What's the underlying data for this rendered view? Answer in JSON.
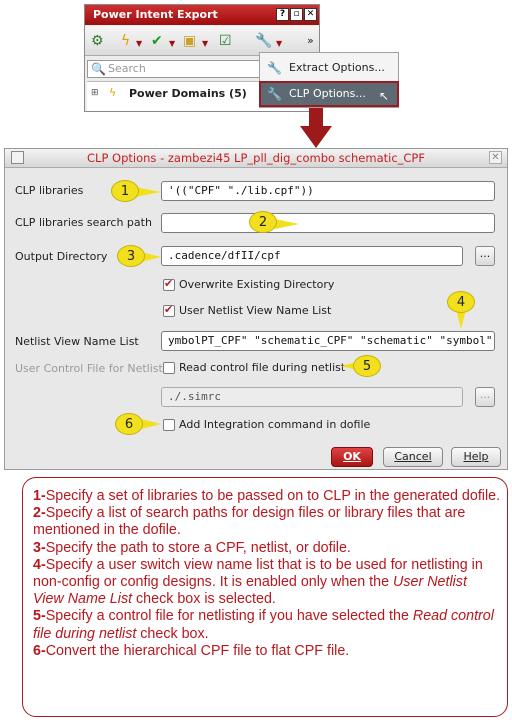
{
  "panel": {
    "title": "Power Intent Export",
    "search_placeholder": "Search",
    "tree_item": "Power Domains (5)"
  },
  "menu": {
    "items": [
      {
        "label": "Extract Options..."
      },
      {
        "label": "CLP Options..."
      }
    ]
  },
  "dialog": {
    "title": "CLP Options - zambezi45 LP_pll_dig_combo schematic_CPF",
    "clp_libraries_label": "CLP libraries",
    "clp_libraries_value": "'((\"CPF\" \"./lib.cpf\"))",
    "search_path_label": "CLP libraries search path",
    "search_path_value": "",
    "output_dir_label": "Output Directory",
    "output_dir_value": ".cadence/dfII/cpf",
    "browse_label": "...",
    "overwrite_label": "Overwrite Existing Directory",
    "user_netlist_label": "User Netlist View Name List",
    "netlist_view_label": "Netlist View Name List",
    "netlist_view_value": "ymbolPT_CPF\" \"schematic_CPF\" \"schematic\" \"symbol\")",
    "user_control_label": "User Control File for Netlist",
    "read_control_label": "Read control file during netlist",
    "control_file_value": "./.simrc",
    "integration_label": "Add Integration command in dofile",
    "ok_label": "OK",
    "cancel_label": "Cancel",
    "help_label": "Help",
    "overwrite_checked": true,
    "user_netlist_checked": true,
    "read_control_checked": false,
    "integration_checked": false
  },
  "callouts": [
    "1",
    "2",
    "3",
    "4",
    "5",
    "6"
  ],
  "notes": [
    {
      "num": "1-",
      "text": "Specify a set of libraries to be passed on to CLP in the generated dofile."
    },
    {
      "num": "2-",
      "text": "Specify a list of search paths for design files or library files that are mentioned in the dofile."
    },
    {
      "num": "3-",
      "text": "Specify the path to store a CPF, netlist, or dofile."
    },
    {
      "num": "4-",
      "text_a": "Specify a user switch view name list that is to be used for netlisting  in non-config or config designs. It is enabled only when the ",
      "text_i": "User Netlist View Name List",
      "text_b": " check box is selected."
    },
    {
      "num": "5-",
      "text_a": "Specify a control file for netlisting if you have selected the ",
      "text_i": "Read control file during netlist",
      "text_b": " check box."
    },
    {
      "num": "6-",
      "text": "Convert the hierarchical CPF file to flat CPF file."
    }
  ],
  "colors": {
    "accent_red": "#b8181e",
    "callout_yellow": "#f2e01f",
    "title_red": "#c81e1e"
  }
}
